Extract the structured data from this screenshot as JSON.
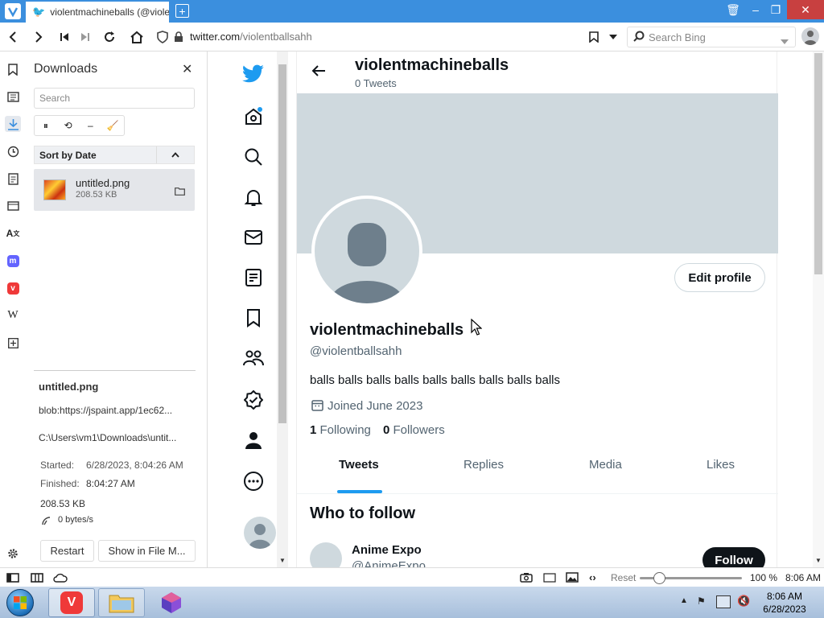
{
  "browser": {
    "tab_title": "violentmachineballs (@violentballsahh) / Twitter",
    "url_domain": "twitter.com",
    "url_path": "/violentballsahh",
    "search_placeholder": "Search Bing"
  },
  "downloads": {
    "title": "Downloads",
    "search_placeholder": "Search",
    "sort_label": "Sort by Date",
    "item": {
      "name": "untitled.png",
      "size": "208.53 KB"
    },
    "details": {
      "name": "untitled.png",
      "source": "blob:https://jspaint.app/1ec62...",
      "path": "C:\\Users\\vm1\\Downloads\\untit...",
      "started_label": "Started:",
      "started_value": "6/28/2023, 8:04:26 AM",
      "finished_label": "Finished:",
      "finished_value": "8:04:27 AM",
      "size": "208.53 KB",
      "speed": "0 bytes/s"
    },
    "restart_label": "Restart",
    "show_label": "Show in File M..."
  },
  "profile": {
    "header_name": "violentmachineballs",
    "tweet_count": "0 Tweets",
    "edit_label": "Edit profile",
    "name": "violentmachineballs",
    "handle": "@violentballsahh",
    "bio": "balls balls balls balls balls balls balls balls balls",
    "joined": "Joined June 2023",
    "following_count": "1",
    "following_label": "Following",
    "followers_count": "0",
    "followers_label": "Followers",
    "tabs": [
      "Tweets",
      "Replies",
      "Media",
      "Likes"
    ],
    "who_to_follow": "Who to follow",
    "suggestion_name": "Anime Expo",
    "suggestion_handle": "@AnimeExpo",
    "follow_label": "Follow"
  },
  "statusbar": {
    "reset": "Reset",
    "zoom": "100 %",
    "time": "8:06 AM"
  },
  "taskbar": {
    "time": "8:06 AM",
    "date": "6/28/2023"
  },
  "colors": {
    "titlebar": "#3b8fde",
    "twitter_blue": "#1d9bf0",
    "banner": "#cfd9de"
  }
}
